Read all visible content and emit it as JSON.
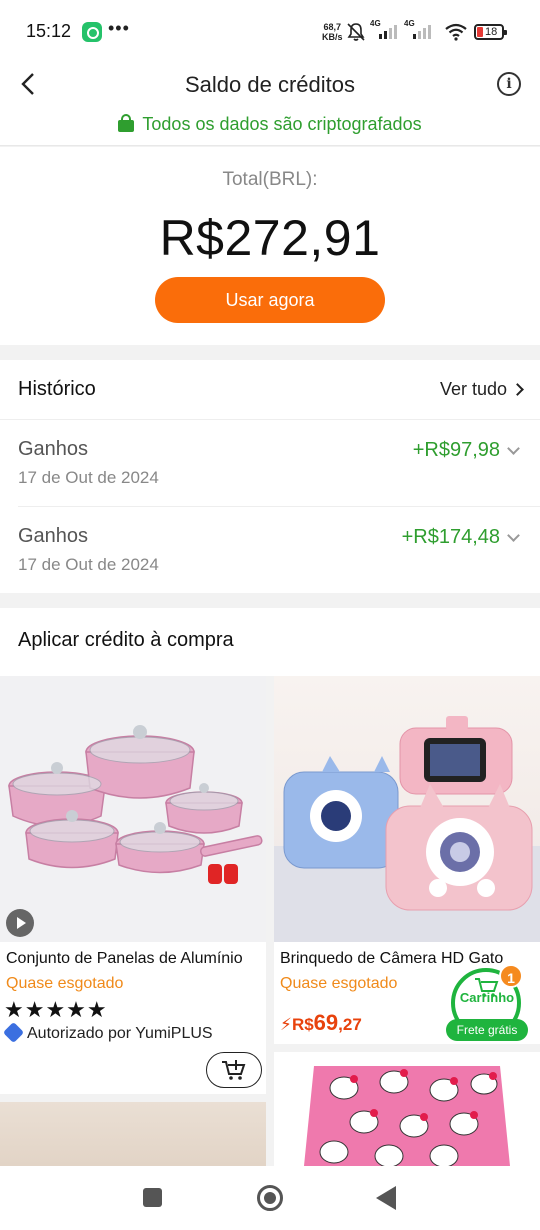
{
  "status_bar": {
    "time": "15:12",
    "net_speed_value": "68,7",
    "net_speed_unit": "KB/s",
    "network_1": "4G",
    "network_2": "4G",
    "battery": "18",
    "icons": [
      "whatsapp-icon",
      "more-dots-icon",
      "bell-off-icon",
      "signal-icon",
      "wifi-icon",
      "battery-icon"
    ]
  },
  "header": {
    "title": "Saldo de créditos",
    "secure_text": "Todos os dados são criptografados",
    "icons": [
      "back-icon",
      "info-icon",
      "lock-icon"
    ]
  },
  "balance": {
    "label": "Total(BRL):",
    "value": "R$272,91",
    "button": "Usar agora"
  },
  "history": {
    "title": "Histórico",
    "see_all": "Ver tudo",
    "items": [
      {
        "type": "Ganhos",
        "date": "17 de Out de 2024",
        "amount": "+R$97,98"
      },
      {
        "type": "Ganhos",
        "date": "17 de Out de 2024",
        "amount": "+R$174,48"
      }
    ]
  },
  "apply": {
    "title": "Aplicar crédito à compra"
  },
  "products": [
    {
      "name": "Conjunto de Panelas de Alumínio",
      "stock": "Quase esgotado",
      "stars": "★★★★★",
      "rating": 5,
      "authorized": "Autorizado por YumiPLUS"
    },
    {
      "name": "Brinquedo de Câmera HD Gato",
      "stock": "Quase esgotado",
      "price_currency": "R$",
      "price_int": "69",
      "price_dec": ",27"
    }
  ],
  "floating_cart": {
    "label": "Carrinho",
    "badge": "1",
    "free_shipping": "Frete grátis"
  },
  "colors": {
    "accent_orange": "#fa6d0a",
    "success_green": "#2f9e2f",
    "stock_orange": "#f08a1a",
    "price_red": "#e8420c",
    "cart_green": "#1fb43e"
  }
}
